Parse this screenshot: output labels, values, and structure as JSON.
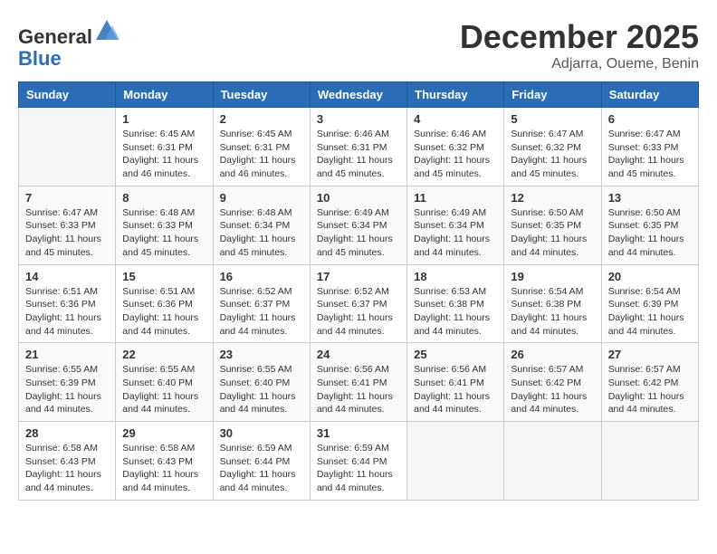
{
  "header": {
    "logo_line1": "General",
    "logo_line2": "Blue",
    "month": "December 2025",
    "location": "Adjarra, Oueme, Benin"
  },
  "days_of_week": [
    "Sunday",
    "Monday",
    "Tuesday",
    "Wednesday",
    "Thursday",
    "Friday",
    "Saturday"
  ],
  "weeks": [
    [
      {
        "day": "",
        "info": ""
      },
      {
        "day": "1",
        "info": "Sunrise: 6:45 AM\nSunset: 6:31 PM\nDaylight: 11 hours\nand 46 minutes."
      },
      {
        "day": "2",
        "info": "Sunrise: 6:45 AM\nSunset: 6:31 PM\nDaylight: 11 hours\nand 46 minutes."
      },
      {
        "day": "3",
        "info": "Sunrise: 6:46 AM\nSunset: 6:31 PM\nDaylight: 11 hours\nand 45 minutes."
      },
      {
        "day": "4",
        "info": "Sunrise: 6:46 AM\nSunset: 6:32 PM\nDaylight: 11 hours\nand 45 minutes."
      },
      {
        "day": "5",
        "info": "Sunrise: 6:47 AM\nSunset: 6:32 PM\nDaylight: 11 hours\nand 45 minutes."
      },
      {
        "day": "6",
        "info": "Sunrise: 6:47 AM\nSunset: 6:33 PM\nDaylight: 11 hours\nand 45 minutes."
      }
    ],
    [
      {
        "day": "7",
        "info": "Sunrise: 6:47 AM\nSunset: 6:33 PM\nDaylight: 11 hours\nand 45 minutes."
      },
      {
        "day": "8",
        "info": "Sunrise: 6:48 AM\nSunset: 6:33 PM\nDaylight: 11 hours\nand 45 minutes."
      },
      {
        "day": "9",
        "info": "Sunrise: 6:48 AM\nSunset: 6:34 PM\nDaylight: 11 hours\nand 45 minutes."
      },
      {
        "day": "10",
        "info": "Sunrise: 6:49 AM\nSunset: 6:34 PM\nDaylight: 11 hours\nand 45 minutes."
      },
      {
        "day": "11",
        "info": "Sunrise: 6:49 AM\nSunset: 6:34 PM\nDaylight: 11 hours\nand 44 minutes."
      },
      {
        "day": "12",
        "info": "Sunrise: 6:50 AM\nSunset: 6:35 PM\nDaylight: 11 hours\nand 44 minutes."
      },
      {
        "day": "13",
        "info": "Sunrise: 6:50 AM\nSunset: 6:35 PM\nDaylight: 11 hours\nand 44 minutes."
      }
    ],
    [
      {
        "day": "14",
        "info": "Sunrise: 6:51 AM\nSunset: 6:36 PM\nDaylight: 11 hours\nand 44 minutes."
      },
      {
        "day": "15",
        "info": "Sunrise: 6:51 AM\nSunset: 6:36 PM\nDaylight: 11 hours\nand 44 minutes."
      },
      {
        "day": "16",
        "info": "Sunrise: 6:52 AM\nSunset: 6:37 PM\nDaylight: 11 hours\nand 44 minutes."
      },
      {
        "day": "17",
        "info": "Sunrise: 6:52 AM\nSunset: 6:37 PM\nDaylight: 11 hours\nand 44 minutes."
      },
      {
        "day": "18",
        "info": "Sunrise: 6:53 AM\nSunset: 6:38 PM\nDaylight: 11 hours\nand 44 minutes."
      },
      {
        "day": "19",
        "info": "Sunrise: 6:54 AM\nSunset: 6:38 PM\nDaylight: 11 hours\nand 44 minutes."
      },
      {
        "day": "20",
        "info": "Sunrise: 6:54 AM\nSunset: 6:39 PM\nDaylight: 11 hours\nand 44 minutes."
      }
    ],
    [
      {
        "day": "21",
        "info": "Sunrise: 6:55 AM\nSunset: 6:39 PM\nDaylight: 11 hours\nand 44 minutes."
      },
      {
        "day": "22",
        "info": "Sunrise: 6:55 AM\nSunset: 6:40 PM\nDaylight: 11 hours\nand 44 minutes."
      },
      {
        "day": "23",
        "info": "Sunrise: 6:55 AM\nSunset: 6:40 PM\nDaylight: 11 hours\nand 44 minutes."
      },
      {
        "day": "24",
        "info": "Sunrise: 6:56 AM\nSunset: 6:41 PM\nDaylight: 11 hours\nand 44 minutes."
      },
      {
        "day": "25",
        "info": "Sunrise: 6:56 AM\nSunset: 6:41 PM\nDaylight: 11 hours\nand 44 minutes."
      },
      {
        "day": "26",
        "info": "Sunrise: 6:57 AM\nSunset: 6:42 PM\nDaylight: 11 hours\nand 44 minutes."
      },
      {
        "day": "27",
        "info": "Sunrise: 6:57 AM\nSunset: 6:42 PM\nDaylight: 11 hours\nand 44 minutes."
      }
    ],
    [
      {
        "day": "28",
        "info": "Sunrise: 6:58 AM\nSunset: 6:43 PM\nDaylight: 11 hours\nand 44 minutes."
      },
      {
        "day": "29",
        "info": "Sunrise: 6:58 AM\nSunset: 6:43 PM\nDaylight: 11 hours\nand 44 minutes."
      },
      {
        "day": "30",
        "info": "Sunrise: 6:59 AM\nSunset: 6:44 PM\nDaylight: 11 hours\nand 44 minutes."
      },
      {
        "day": "31",
        "info": "Sunrise: 6:59 AM\nSunset: 6:44 PM\nDaylight: 11 hours\nand 44 minutes."
      },
      {
        "day": "",
        "info": ""
      },
      {
        "day": "",
        "info": ""
      },
      {
        "day": "",
        "info": ""
      }
    ]
  ]
}
